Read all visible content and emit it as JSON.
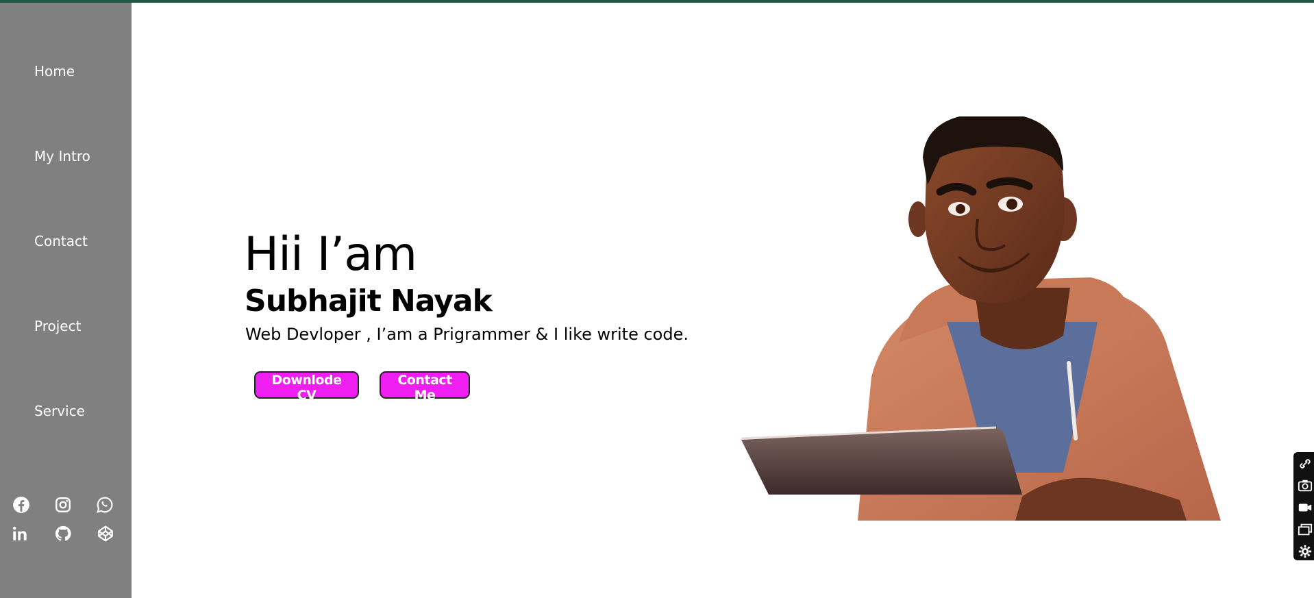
{
  "sidebar": {
    "items": [
      {
        "label": "Home"
      },
      {
        "label": "My Intro"
      },
      {
        "label": "Contact"
      },
      {
        "label": "Project"
      },
      {
        "label": "Service"
      }
    ],
    "social_icons": [
      "facebook-icon",
      "instagram-icon",
      "whatsapp-icon",
      "linkedin-icon",
      "github-icon",
      "codepen-icon"
    ]
  },
  "hero": {
    "greeting": "Hii I’am",
    "name": "Subhajit Nayak",
    "tagline": "Web Devloper , I’am a Prigrammer & I like write code.",
    "cv_button": "Downlode CV",
    "contact_button": "Contact Me",
    "avatar": "avatar-illustration"
  },
  "extension_toolbar": {
    "icons": [
      "link-icon",
      "camera-icon",
      "video-icon",
      "window-icon",
      "gear-icon"
    ]
  },
  "colors": {
    "sidebar": "#808080",
    "button": "#ee1ff0",
    "top_line": "#1e5a46"
  }
}
